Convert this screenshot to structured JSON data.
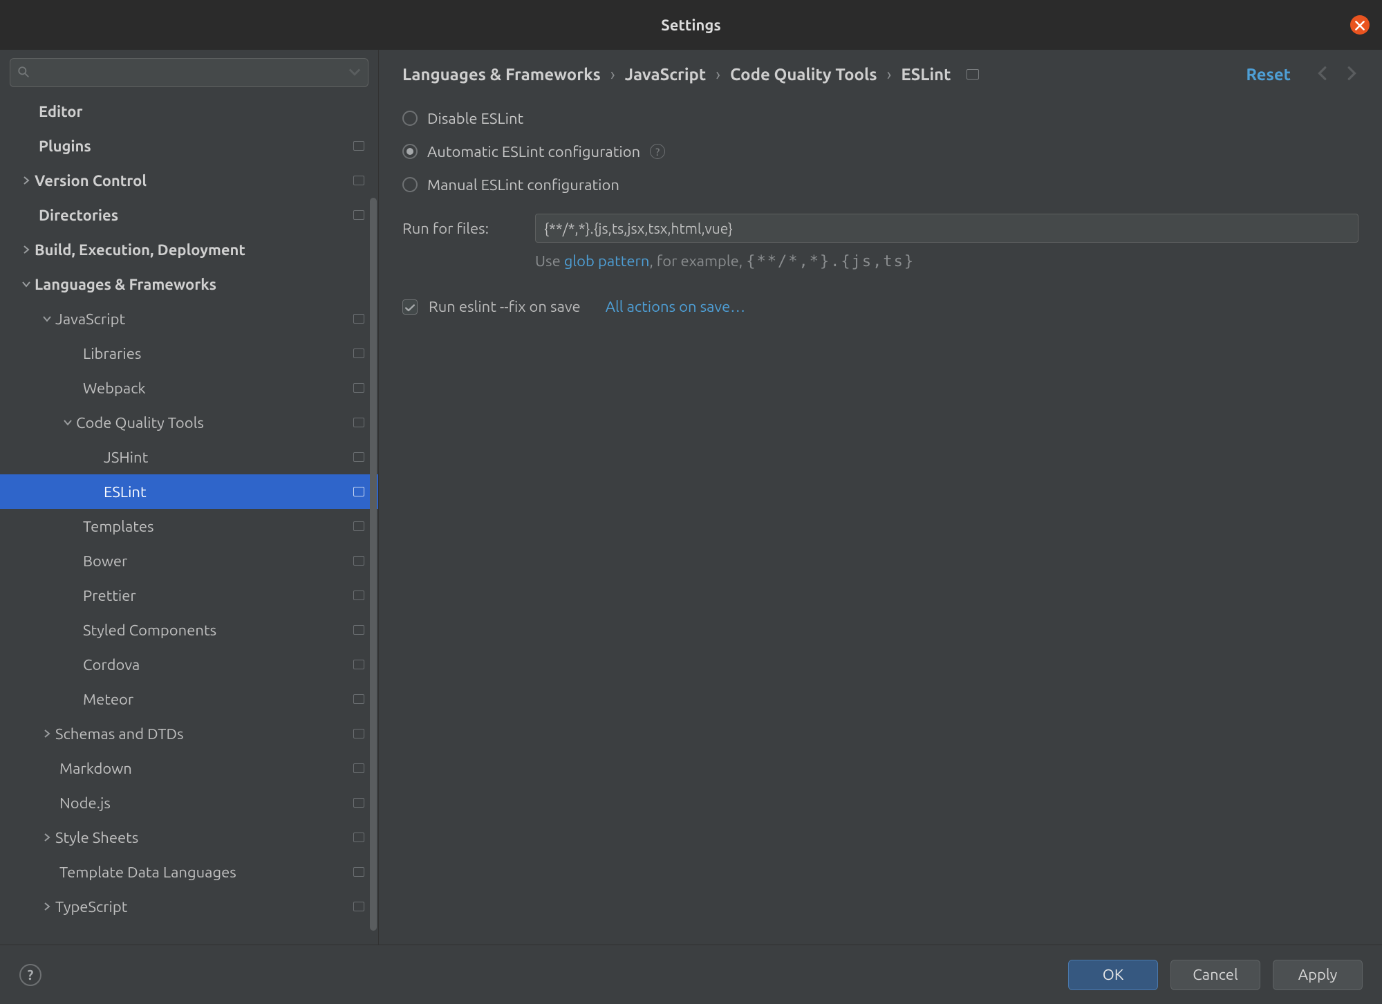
{
  "window": {
    "title": "Settings"
  },
  "search": {
    "placeholder": ""
  },
  "breadcrumb": {
    "items": [
      "Languages & Frameworks",
      "JavaScript",
      "Code Quality Tools",
      "ESLint"
    ]
  },
  "reset_label": "Reset",
  "eslint": {
    "mode_disable": "Disable ESLint",
    "mode_auto": "Automatic ESLint configuration",
    "mode_manual": "Manual ESLint configuration",
    "selected_mode": "auto",
    "run_for_files_label": "Run for files:",
    "run_for_files_value": "{**/*,*}.{js,ts,jsx,tsx,html,vue}",
    "hint_prefix": "Use ",
    "hint_link": "glob pattern",
    "hint_suffix": ", for example, ",
    "hint_example": "{**/*,*}.{js,ts}",
    "fix_on_save_label": "Run eslint --fix on save",
    "fix_on_save_checked": true,
    "all_actions_link": "All actions on save…"
  },
  "footer": {
    "ok": "OK",
    "cancel": "Cancel",
    "apply": "Apply"
  },
  "sidebar": {
    "items": [
      {
        "label": "Editor",
        "depth": 0,
        "bold": true,
        "caret": "",
        "badge": false
      },
      {
        "label": "Plugins",
        "depth": 0,
        "bold": true,
        "caret": "",
        "badge": true
      },
      {
        "label": "Version Control",
        "depth": 0,
        "bold": true,
        "caret": "right",
        "badge": true
      },
      {
        "label": "Directories",
        "depth": 0,
        "bold": true,
        "caret": "",
        "badge": true
      },
      {
        "label": "Build, Execution, Deployment",
        "depth": 0,
        "bold": true,
        "caret": "right",
        "badge": false
      },
      {
        "label": "Languages & Frameworks",
        "depth": 0,
        "bold": true,
        "caret": "down",
        "badge": false
      },
      {
        "label": "JavaScript",
        "depth": 1,
        "bold": false,
        "caret": "down",
        "badge": true
      },
      {
        "label": "Libraries",
        "depth": 2,
        "bold": false,
        "caret": "",
        "badge": true
      },
      {
        "label": "Webpack",
        "depth": 2,
        "bold": false,
        "caret": "",
        "badge": true
      },
      {
        "label": "Code Quality Tools",
        "depth": 2,
        "bold": false,
        "caret": "down",
        "badge": true
      },
      {
        "label": "JSHint",
        "depth": 3,
        "bold": false,
        "caret": "",
        "badge": true
      },
      {
        "label": "ESLint",
        "depth": 3,
        "bold": false,
        "caret": "",
        "badge": true,
        "selected": true
      },
      {
        "label": "Templates",
        "depth": 2,
        "bold": false,
        "caret": "",
        "badge": true
      },
      {
        "label": "Bower",
        "depth": 2,
        "bold": false,
        "caret": "",
        "badge": true
      },
      {
        "label": "Prettier",
        "depth": 2,
        "bold": false,
        "caret": "",
        "badge": true
      },
      {
        "label": "Styled Components",
        "depth": 2,
        "bold": false,
        "caret": "",
        "badge": true
      },
      {
        "label": "Cordova",
        "depth": 2,
        "bold": false,
        "caret": "",
        "badge": true
      },
      {
        "label": "Meteor",
        "depth": 2,
        "bold": false,
        "caret": "",
        "badge": true
      },
      {
        "label": "Schemas and DTDs",
        "depth": 1,
        "bold": false,
        "caret": "right",
        "badge": true
      },
      {
        "label": "Markdown",
        "depth": 1,
        "bold": false,
        "caret": "",
        "badge": true
      },
      {
        "label": "Node.js",
        "depth": 1,
        "bold": false,
        "caret": "",
        "badge": true
      },
      {
        "label": "Style Sheets",
        "depth": 1,
        "bold": false,
        "caret": "right",
        "badge": true
      },
      {
        "label": "Template Data Languages",
        "depth": 1,
        "bold": false,
        "caret": "",
        "badge": true
      },
      {
        "label": "TypeScript",
        "depth": 1,
        "bold": false,
        "caret": "right",
        "badge": true
      }
    ]
  }
}
